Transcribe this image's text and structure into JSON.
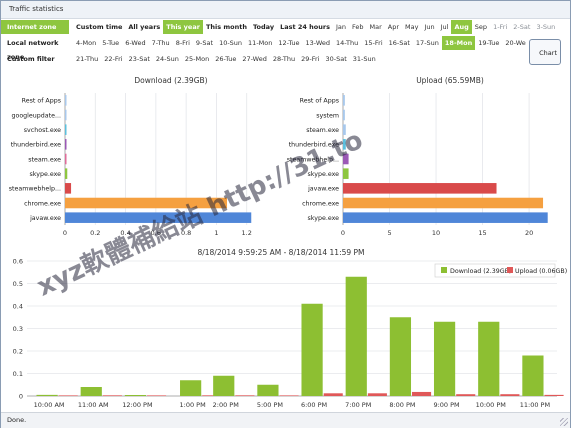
{
  "window": {
    "title": "Traffic statistics"
  },
  "filters": {
    "zones": [
      {
        "label": "Internet zone",
        "active": true
      },
      {
        "label": "Local network zone",
        "active": false
      },
      {
        "label": "Custom filter",
        "active": false
      }
    ],
    "row1": [
      {
        "label": "Custom time",
        "style": "bold"
      },
      {
        "label": "All years",
        "style": "bold"
      },
      {
        "label": "This year",
        "style": "sel"
      },
      {
        "label": "This month",
        "style": "bold"
      },
      {
        "label": "Today",
        "style": "bold"
      },
      {
        "label": "Last 24 hours",
        "style": "bold"
      },
      {
        "label": "Jan",
        "style": ""
      },
      {
        "label": "Feb",
        "style": ""
      },
      {
        "label": "Mar",
        "style": ""
      },
      {
        "label": "Apr",
        "style": ""
      },
      {
        "label": "May",
        "style": ""
      },
      {
        "label": "Jun",
        "style": ""
      },
      {
        "label": "Jul",
        "style": ""
      },
      {
        "label": "Aug",
        "style": "sel"
      },
      {
        "label": "Sep",
        "style": ""
      },
      {
        "label": "1-Fri",
        "style": "dim"
      },
      {
        "label": "2-Sat",
        "style": "dim"
      },
      {
        "label": "3-Sun",
        "style": "dim"
      }
    ],
    "row2": [
      {
        "label": "4-Mon",
        "style": ""
      },
      {
        "label": "5-Tue",
        "style": ""
      },
      {
        "label": "6-Wed",
        "style": ""
      },
      {
        "label": "7-Thu",
        "style": ""
      },
      {
        "label": "8-Fri",
        "style": ""
      },
      {
        "label": "9-Sat",
        "style": ""
      },
      {
        "label": "10-Sun",
        "style": ""
      },
      {
        "label": "11-Mon",
        "style": ""
      },
      {
        "label": "12-Tue",
        "style": ""
      },
      {
        "label": "13-Wed",
        "style": ""
      },
      {
        "label": "14-Thu",
        "style": ""
      },
      {
        "label": "15-Fri",
        "style": ""
      },
      {
        "label": "16-Sat",
        "style": ""
      },
      {
        "label": "17-Sun",
        "style": ""
      },
      {
        "label": "18-Mon",
        "style": "sel"
      },
      {
        "label": "19-Tue",
        "style": ""
      },
      {
        "label": "20-We",
        "style": ""
      }
    ],
    "row3": [
      {
        "label": "21-Thu",
        "style": ""
      },
      {
        "label": "22-Fri",
        "style": ""
      },
      {
        "label": "23-Sat",
        "style": ""
      },
      {
        "label": "24-Sun",
        "style": ""
      },
      {
        "label": "25-Mon",
        "style": ""
      },
      {
        "label": "26-Tue",
        "style": ""
      },
      {
        "label": "27-Wed",
        "style": ""
      },
      {
        "label": "28-Thu",
        "style": ""
      },
      {
        "label": "29-Fri",
        "style": ""
      },
      {
        "label": "30-Sat",
        "style": ""
      },
      {
        "label": "31-Sun",
        "style": ""
      }
    ],
    "chart_button": "Chart"
  },
  "colors": {
    "green": "#8ec63f",
    "download": "#8dbf32",
    "upload": "#e05858",
    "orange": "#f5a040",
    "blue": "#4f86d8",
    "red": "#d94a4a",
    "pink": "#e06c9a",
    "purple": "#9b59b6",
    "cyan": "#5bc0de",
    "lightblue": "#a8c8ec"
  },
  "status": {
    "text": "Done."
  },
  "watermark": "xyz軟體補給站  http://31.to",
  "chart_data": [
    {
      "type": "bar",
      "orientation": "horizontal",
      "title": "Download (2.39GB)",
      "categories": [
        "javaw.exe",
        "chrome.exe",
        "steamwebhelp...",
        "skype.exe",
        "steam.exe",
        "thunderbird.exe",
        "svchost.exe",
        "googleupdate...",
        "Rest of Apps"
      ],
      "values": [
        1.23,
        1.07,
        0.04,
        0.015,
        0.01,
        0.005,
        0.004,
        0.003,
        0.003
      ],
      "bar_colors": [
        "blue",
        "orange",
        "red",
        "green",
        "pink",
        "purple",
        "cyan",
        "lightblue",
        "lightblue"
      ],
      "xlim": [
        0,
        1.4
      ],
      "xticks": [
        "0",
        "0.2",
        "0.4",
        "0.6",
        "0.8",
        "1",
        "1.2"
      ]
    },
    {
      "type": "bar",
      "orientation": "horizontal",
      "title": "Upload (65.59MB)",
      "categories": [
        "skype.exe",
        "chrome.exe",
        "javaw.exe",
        "skype.exe",
        "steamwebhelp...",
        "thunderbird.exe",
        "steam.exe",
        "system",
        "Rest of Apps"
      ],
      "values": [
        22,
        21.5,
        16.5,
        0.6,
        0.6,
        0.3,
        0.3,
        0.2,
        0.2
      ],
      "bar_colors": [
        "blue",
        "orange",
        "red",
        "green",
        "purple",
        "cyan",
        "lightblue",
        "lightblue",
        "lightblue"
      ],
      "xlim": [
        0,
        23
      ],
      "xticks": [
        "0",
        "5",
        "10",
        "15",
        "20"
      ]
    },
    {
      "type": "bar",
      "title": "8/18/2014 9:59:25 AM - 8/18/2014 11:59 PM",
      "categories": [
        "10:00 AM",
        "11:00 AM",
        "12:00 PM",
        "1:00 PM",
        "2:00 PM",
        "5:00 PM",
        "6:00 PM",
        "7:00 PM",
        "8:00 PM",
        "9:00 PM",
        "10:00 PM",
        "11:00 PM"
      ],
      "x_positions": [
        0,
        1,
        2,
        3.25,
        4,
        5,
        6,
        7,
        8,
        9,
        10,
        11
      ],
      "xticks": [
        "10:00 AM",
        "11:00 AM",
        "12:00 PM",
        "1:00 PM",
        "2:00 PM",
        "5:00 PM",
        "6:00 PM",
        "7:00 PM",
        "8:00 PM",
        "9:00 PM",
        "10:00 PM",
        "11:00 PM"
      ],
      "series": [
        {
          "name": "Download (2.39GB)",
          "color": "download",
          "values": [
            0.005,
            0.04,
            0.0,
            0.07,
            0.09,
            0.05,
            0.41,
            0.53,
            0.35,
            0.33,
            0.33,
            0.18
          ]
        },
        {
          "name": "Upload (0.06GB)",
          "color": "upload",
          "values": [
            0.0,
            0.003,
            0.0,
            0.003,
            0.003,
            0.002,
            0.012,
            0.012,
            0.018,
            0.008,
            0.008,
            0.005
          ]
        }
      ],
      "ylim": [
        0,
        0.6
      ],
      "yticks": [
        "0",
        "0.1",
        "0.2",
        "0.3",
        "0.4",
        "0.5",
        "0.6"
      ],
      "legend": "top-right",
      "grid": true
    }
  ]
}
